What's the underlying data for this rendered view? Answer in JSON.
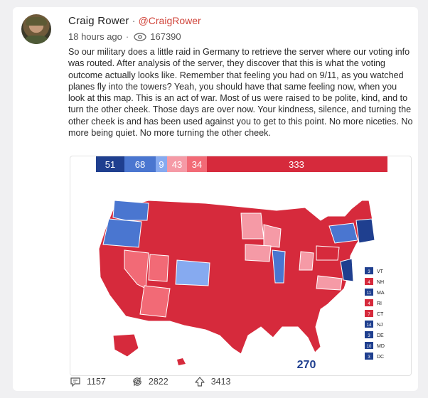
{
  "post": {
    "author": "Craig Rower",
    "separator": "·",
    "handle": "@CraigRower",
    "time": "18 hours ago",
    "time_separator": "·",
    "views": "167390",
    "body": "So our military does a little raid in Germany to retrieve the server where our voting info was routed. After analysis of the server, they discover that this is what the voting outcome actually looks like. Remember that feeling you had on 9/11, as you watched planes fly into the towers? Yeah, you should have that same feeling now, when you look at this map. This is an act of war. Most of us were raised to be polite, kind, and to turn the other cheek. Those days are over now. Your kindness, silence, and turning the other cheek is and has been used against you to get to this point. No more niceties. No more being quiet. No more turning the other cheek."
  },
  "map": {
    "bar_labels": [
      "51",
      "68",
      "9",
      "43",
      "34",
      "333"
    ],
    "total": "270",
    "colors": {
      "dem_dark": "#1f3f8f",
      "dem": "#4a76d0",
      "dem_light": "#86aaf0",
      "rep": "#d62a3c",
      "rep_light": "#f26a76",
      "rep_lighter": "#f59aa6"
    },
    "legend": [
      {
        "num": "3",
        "st": "VT"
      },
      {
        "num": "4",
        "st": "NH"
      },
      {
        "num": "11",
        "st": "MA"
      },
      {
        "num": "4",
        "st": "RI"
      },
      {
        "num": "7",
        "st": "CT"
      },
      {
        "num": "14",
        "st": "NJ"
      },
      {
        "num": "3",
        "st": "DE"
      },
      {
        "num": "10",
        "st": "MD"
      },
      {
        "num": "3",
        "st": "DC"
      }
    ]
  },
  "actions": {
    "comments": "1157",
    "reposts": "2822",
    "upvotes": "3413"
  }
}
